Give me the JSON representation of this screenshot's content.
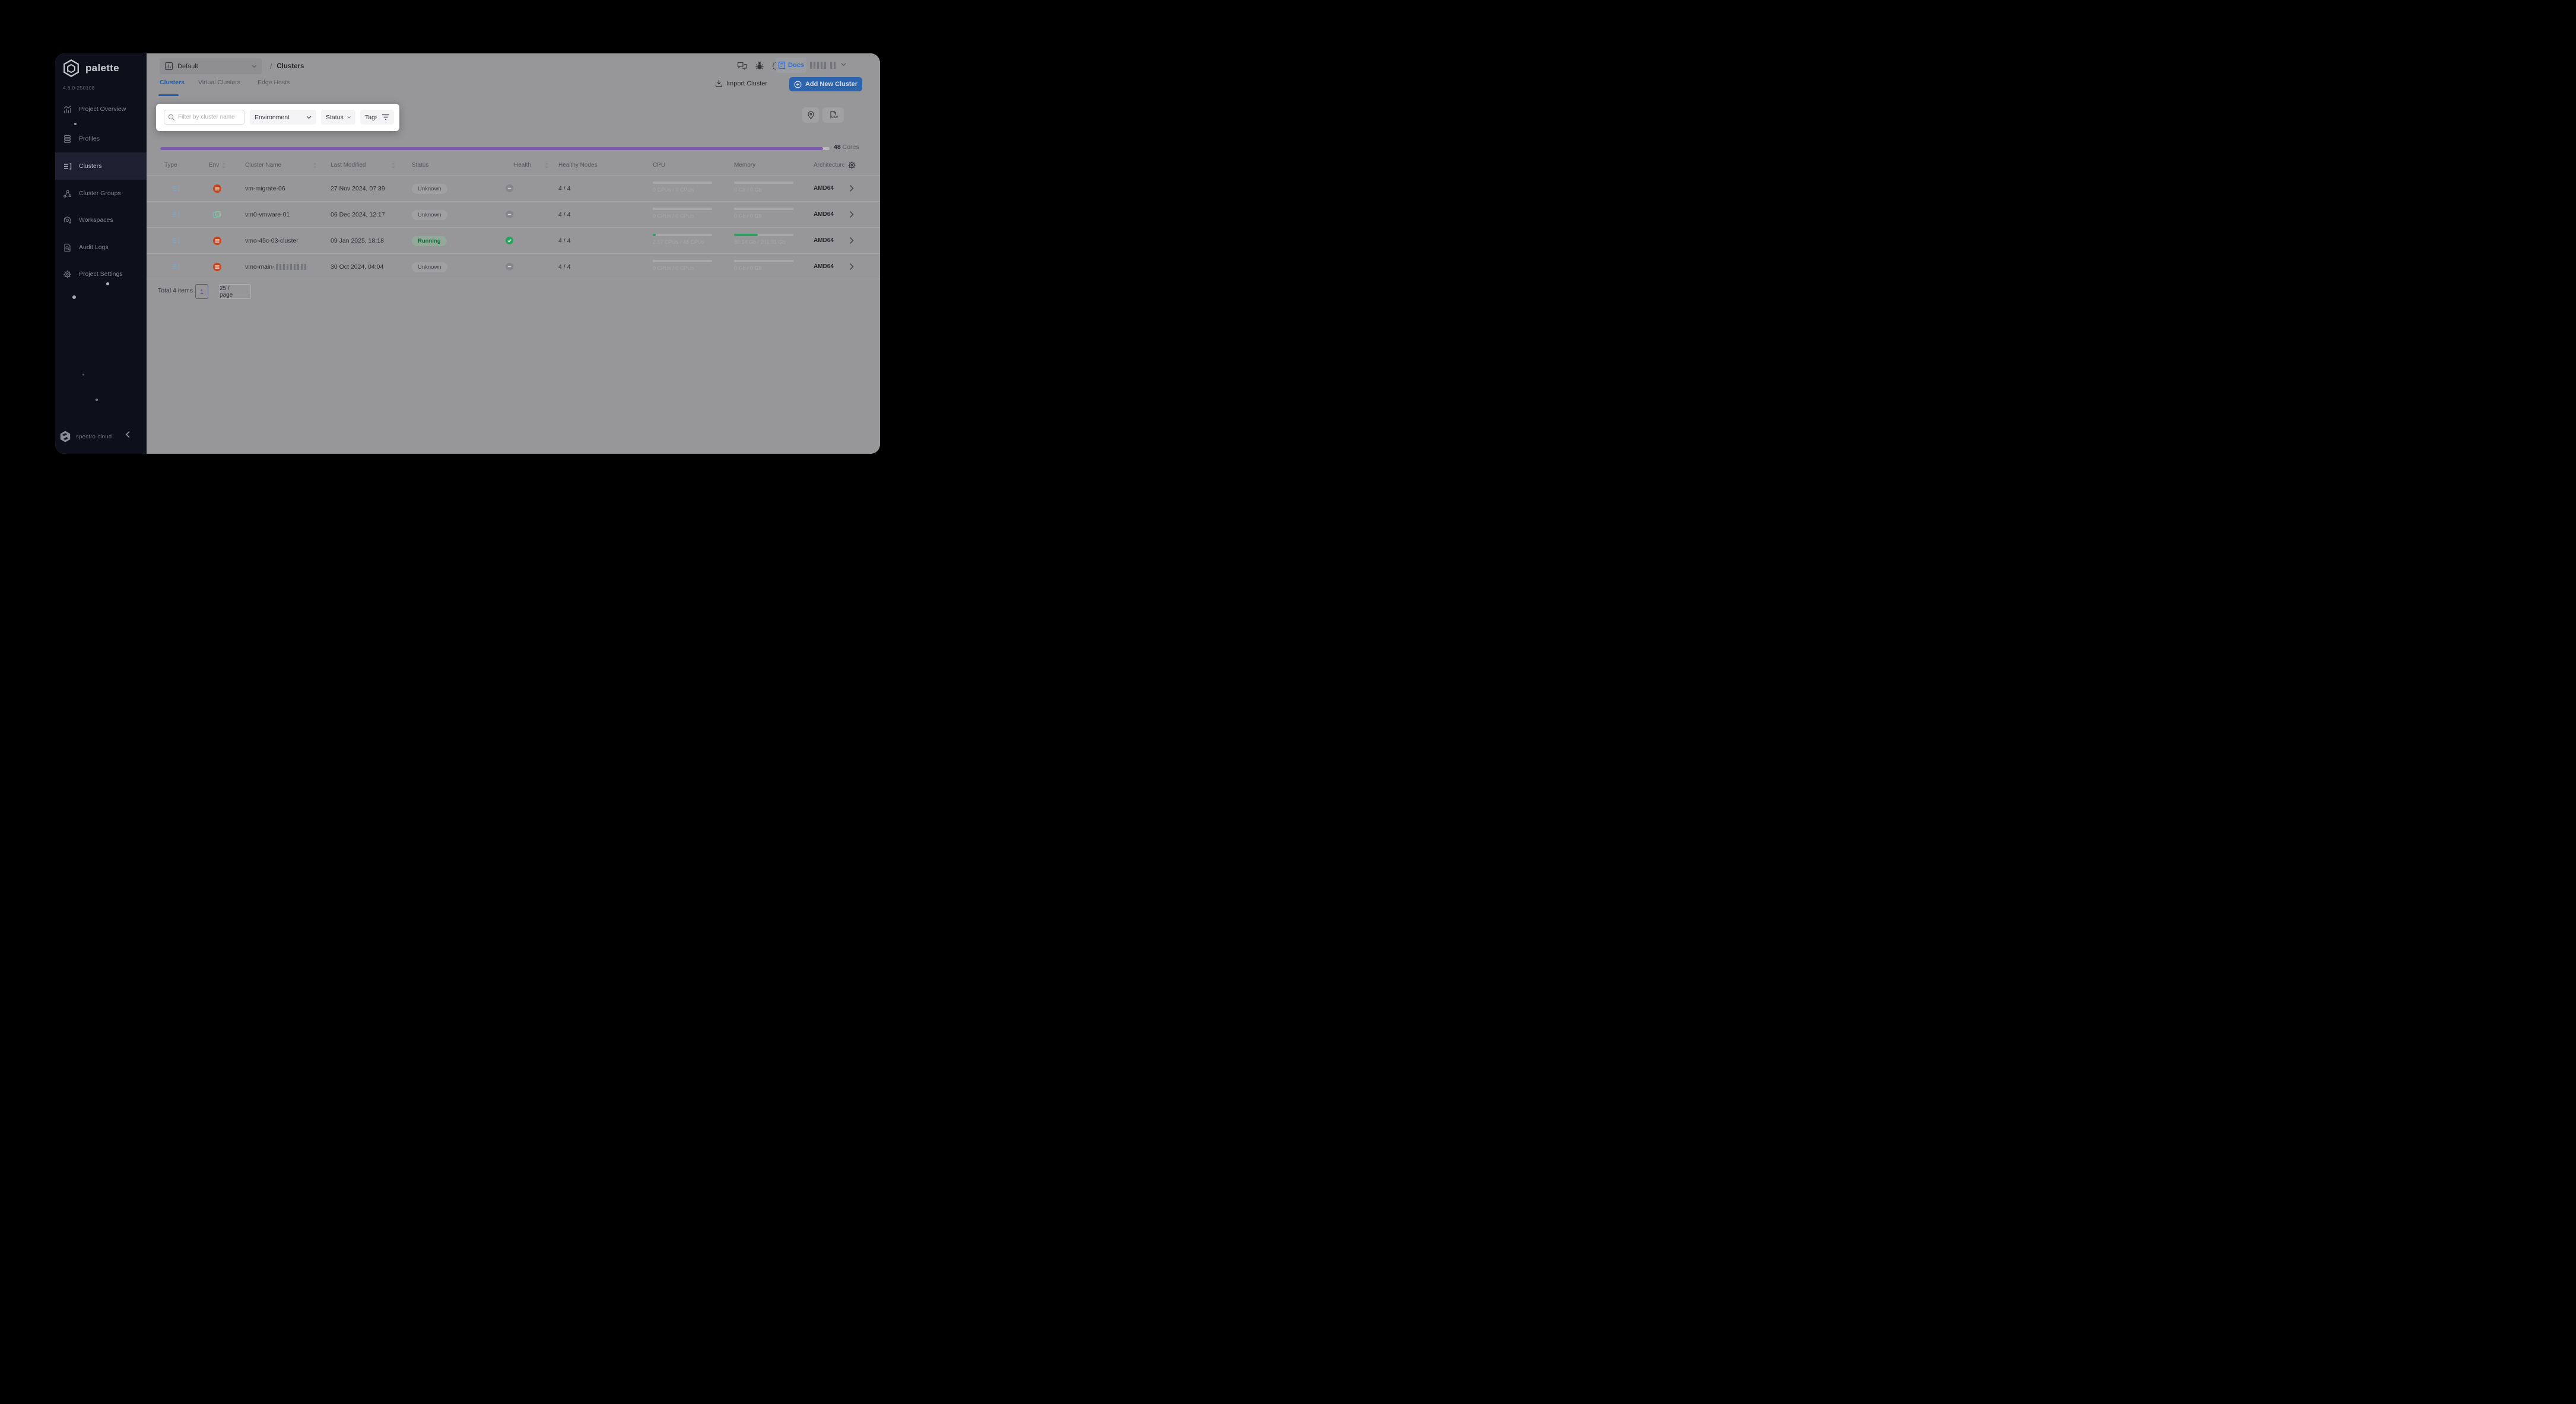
{
  "sidebar": {
    "brand": "palette",
    "version": "4.6.0-250108",
    "items": [
      {
        "label": "Project Overview",
        "icon": "bar-chart"
      },
      {
        "label": "Profiles",
        "icon": "layers"
      },
      {
        "label": "Clusters",
        "icon": "cluster-list",
        "active": true
      },
      {
        "label": "Cluster Groups",
        "icon": "nodes"
      },
      {
        "label": "Workspaces",
        "icon": "orbit"
      },
      {
        "label": "Audit Logs",
        "icon": "doc-search"
      },
      {
        "label": "Project Settings",
        "icon": "gear"
      }
    ],
    "footer_brand": "spectro cloud"
  },
  "topbar": {
    "project_selector": "Default",
    "breadcrumb_separator": "/",
    "page_title": "Clusters",
    "docs_label": "Docs"
  },
  "tabs": {
    "clusters": "Clusters",
    "virtual": "Virtual Clusters",
    "edge": "Edge Hosts",
    "active": "Clusters"
  },
  "actions": {
    "import_label": "Import Cluster",
    "add_label": "Add New Cluster"
  },
  "filter_bar": {
    "search_placeholder": "Filter by cluster name",
    "environment_label": "Environment",
    "status_label": "Status",
    "tags_label": "Tags"
  },
  "usage": {
    "cores_value": "48",
    "cores_unit": "Cores",
    "fill_pct": 99
  },
  "table": {
    "headers": {
      "type": "Type",
      "env": "Env",
      "name": "Cluster Name",
      "modified": "Last Modified",
      "status": "Status",
      "health": "Health",
      "nodes": "Healthy Nodes",
      "cpu": "CPU",
      "memory": "Memory",
      "arch": "Architecture"
    },
    "rows": [
      {
        "name": "vm-migrate-06",
        "env": "openshift",
        "modified": "27 Nov 2024, 07:39",
        "status": "Unknown",
        "health": "unknown",
        "nodes": "4 / 4",
        "cpu_text": "0 CPUs / 0 CPUs",
        "cpu_pct": 0,
        "memory_text": "0 Gb / 0 Gb",
        "memory_pct": 0,
        "arch": "AMD64"
      },
      {
        "name": "vm0-vmware-01",
        "env": "vmware",
        "modified": "06 Dec 2024, 12:17",
        "status": "Unknown",
        "health": "unknown",
        "nodes": "4 / 4",
        "cpu_text": "0 CPUs / 0 CPUs",
        "cpu_pct": 0,
        "memory_text": "0 Gb / 0 Gb",
        "memory_pct": 0,
        "arch": "AMD64"
      },
      {
        "name": "vmo-45c-03-cluster",
        "env": "openshift",
        "modified": "09 Jan 2025, 18:18",
        "status": "Running",
        "health": "ok",
        "nodes": "4 / 4",
        "cpu_text": "2.17 CPUs / 48 CPUs",
        "cpu_pct": 5,
        "memory_text": "80.14 Gb / 201.91 Gb",
        "memory_pct": 40,
        "arch": "AMD64"
      },
      {
        "name": "vmo-main-",
        "name_redacted": true,
        "env": "openshift",
        "modified": "30 Oct 2024, 04:04",
        "status": "Unknown",
        "health": "unknown",
        "nodes": "4 / 4",
        "cpu_text": "0 CPUs / 0 CPUs",
        "cpu_pct": 0,
        "memory_text": "0 Gb / 0 Gb",
        "memory_pct": 0,
        "arch": "AMD64"
      }
    ]
  },
  "pagination": {
    "total_label": "Total 4 items",
    "current_page": "1",
    "page_size": "25 / page"
  },
  "colors": {
    "accent_blue": "#1c5fb8",
    "button_blue": "#2b64ad",
    "docs_blue": "#2f6fd0",
    "usage_purple": "#7c5ca8",
    "health_green": "#27a35d",
    "running_green": "#0e6e38",
    "env_orange": "#c8441c",
    "env_teal": "#66b8ae",
    "sidebar_bg": "#0d0f1a"
  }
}
